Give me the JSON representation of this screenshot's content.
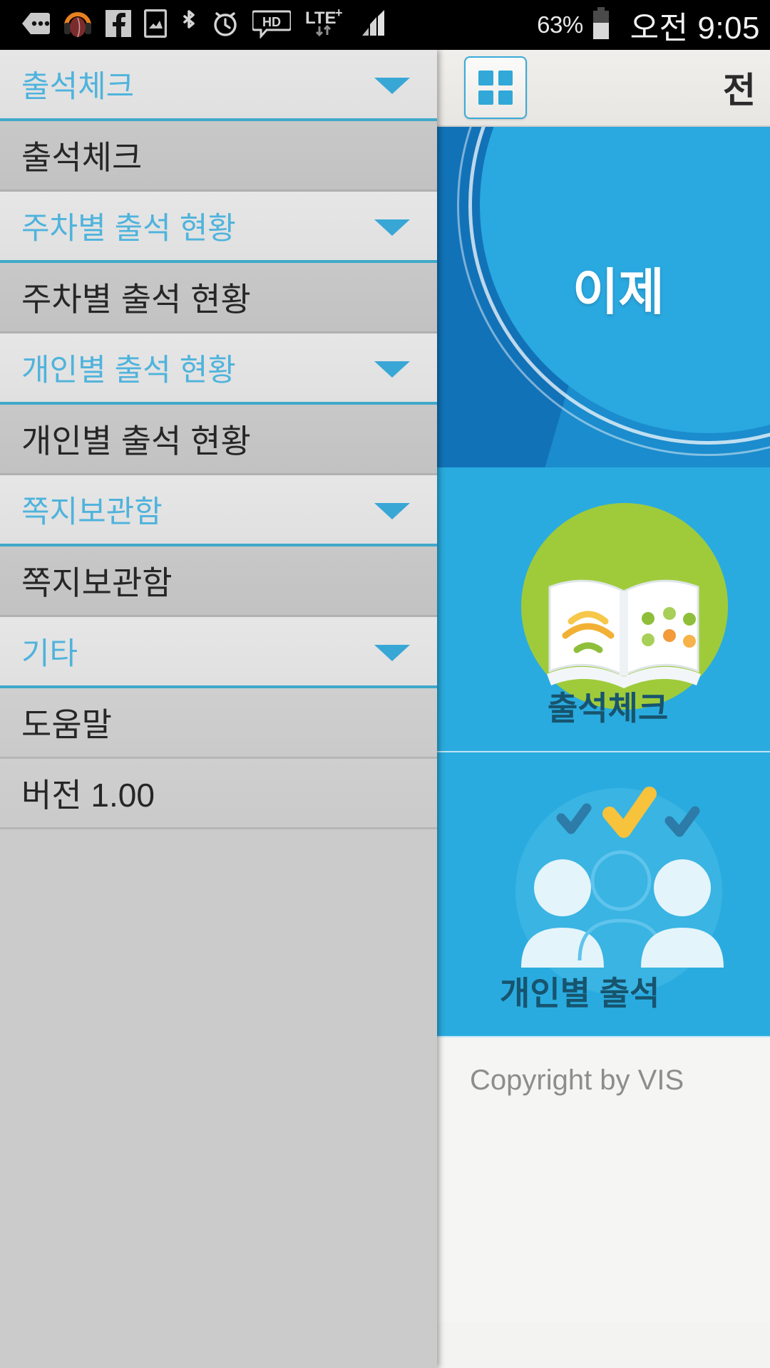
{
  "statusbar": {
    "time": "오전 9:05",
    "battery_percent": "63%",
    "network": "LTE+",
    "icons": [
      "messages-icon",
      "music-headphone-icon",
      "facebook-icon",
      "gallery-icon",
      "bluetooth-icon",
      "alarm-icon",
      "hd-voice-icon",
      "lte-plus-icon",
      "signal-bars-icon",
      "battery-icon"
    ]
  },
  "actionbar": {
    "menu_icon": "grid-menu-icon",
    "title": "전"
  },
  "hero": {
    "text": "이제"
  },
  "drawer": {
    "rows": [
      {
        "type": "group",
        "label": "출석체크",
        "caret": true
      },
      {
        "type": "child",
        "label": "출석체크",
        "caret": false
      },
      {
        "type": "group",
        "label": "주차별 출석 현황",
        "caret": true
      },
      {
        "type": "child",
        "label": "주차별 출석 현황",
        "caret": false
      },
      {
        "type": "group",
        "label": "개인별 출석 현황",
        "caret": true
      },
      {
        "type": "child",
        "label": "개인별 출석 현황",
        "caret": false
      },
      {
        "type": "group",
        "label": "쪽지보관함",
        "caret": true
      },
      {
        "type": "child",
        "label": "쪽지보관함",
        "caret": false
      },
      {
        "type": "group",
        "label": "기타",
        "caret": true
      },
      {
        "type": "plain",
        "label": "도움말",
        "caret": false
      },
      {
        "type": "plain",
        "label": "버전 1.00",
        "caret": false
      }
    ]
  },
  "tiles": [
    {
      "label": "출석체크",
      "icon": "open-book-icon"
    },
    {
      "label": "개인별 출석",
      "icon": "people-check-icon"
    }
  ],
  "footer": {
    "copyright": "Copyright by VIS"
  },
  "colors": {
    "accent_blue": "#31a8d8",
    "header_blue_text": "#4fb3dc",
    "tile_blue": "#2aabdf",
    "hero_blue": "#1b8ccd",
    "book_green": "#9fcb3b",
    "check_yellow": "#f7c23c",
    "drawer_bg": "#cbcbcb"
  }
}
